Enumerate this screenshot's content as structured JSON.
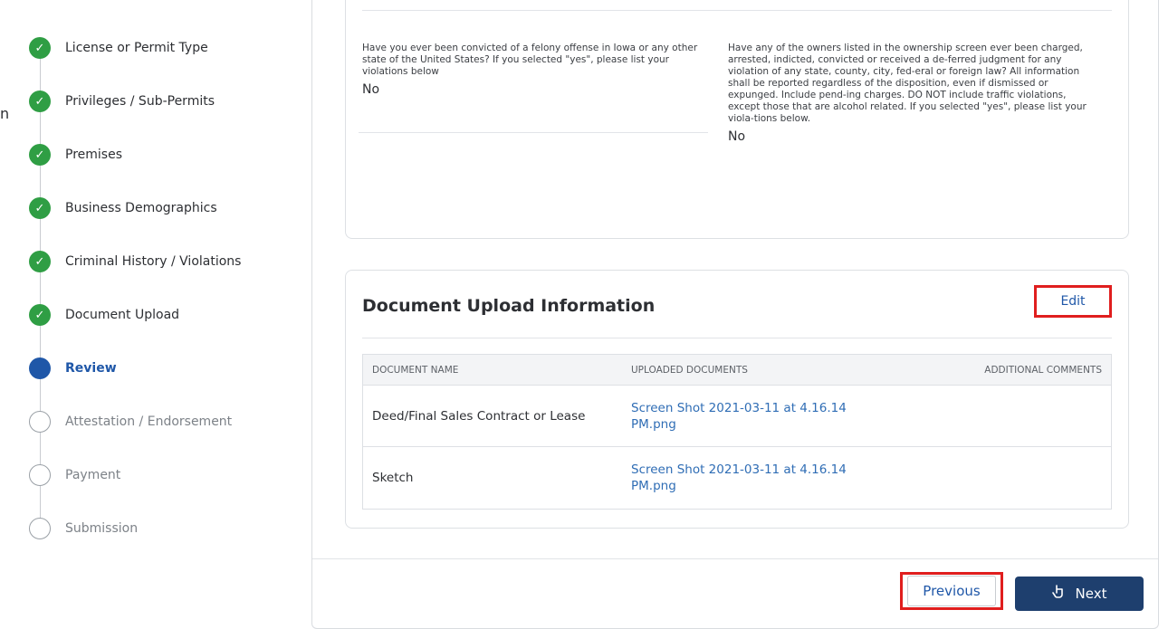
{
  "stepper": {
    "steps": [
      {
        "label": "License or Permit Type",
        "state": "done"
      },
      {
        "label": "Privileges / Sub-Permits",
        "state": "done"
      },
      {
        "label": "Premises",
        "state": "done"
      },
      {
        "label": "Business Demographics",
        "state": "done"
      },
      {
        "label": "Criminal History / Violations",
        "state": "done"
      },
      {
        "label": "Document Upload",
        "state": "done"
      },
      {
        "label": "Review",
        "state": "current"
      },
      {
        "label": "Attestation / Endorsement",
        "state": "todo"
      },
      {
        "label": "Payment",
        "state": "todo"
      },
      {
        "label": "Submission",
        "state": "todo"
      }
    ],
    "check_glyph": "✓",
    "stray_text": "n"
  },
  "criminal": {
    "q1": "Have you ever been convicted of a felony offense in Iowa or any other state of the United States? If you selected \"yes\", please list your violations below",
    "a1": "No",
    "q2": "Have any of the owners listed in the ownership screen ever been charged, arrested, indicted, convicted or received a de-ferred judgment for any violation of any state, county, city, fed-eral or foreign law? All information shall be reported regardless of the disposition, even if dismissed or expunged. Include pend-ing charges. DO NOT include traffic violations, except those that are alcohol related. If you selected \"yes\", please list your viola-tions below.",
    "a2": "No"
  },
  "documents": {
    "title": "Document Upload Information",
    "edit_label": "Edit",
    "headers": [
      "DOCUMENT NAME",
      "UPLOADED DOCUMENTS",
      "ADDITIONAL COMMENTS"
    ],
    "rows": [
      {
        "name": "Deed/Final Sales Contract or Lease",
        "file": "Screen Shot 2021-03-11 at 4.16.14 PM.png",
        "comments": ""
      },
      {
        "name": "Sketch",
        "file": "Screen Shot 2021-03-11 at 4.16.14 PM.png",
        "comments": ""
      }
    ]
  },
  "footer": {
    "previous_label": "Previous",
    "next_label": "Next"
  },
  "colors": {
    "done": "#2f9e44",
    "current": "#1f57a8",
    "primary_button": "#1e3f6e",
    "highlight": "#e01e1e",
    "link": "#2f6db5"
  }
}
